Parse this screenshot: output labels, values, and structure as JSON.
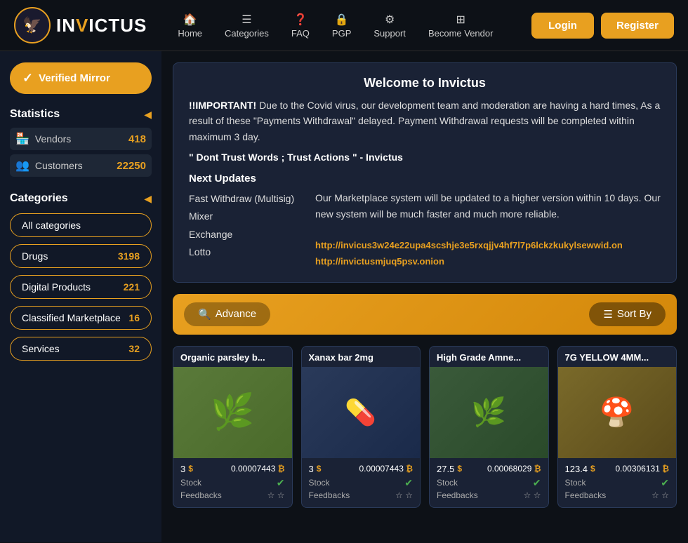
{
  "header": {
    "logo_text_main": "IN",
    "logo_text_v": "V",
    "logo_text_end": "ICTUS",
    "nav": [
      {
        "label": "Home",
        "icon": "🏠",
        "id": "home"
      },
      {
        "label": "Categories",
        "icon": "≡",
        "id": "categories"
      },
      {
        "label": "FAQ",
        "icon": "?",
        "id": "faq"
      },
      {
        "label": "PGP",
        "icon": "🔒",
        "id": "pgp"
      },
      {
        "label": "Support",
        "icon": "⚙",
        "id": "support"
      },
      {
        "label": "Become Vendor",
        "icon": "⊞",
        "id": "become-vendor"
      }
    ],
    "login_label": "Login",
    "register_label": "Register"
  },
  "sidebar": {
    "verified_mirror_label": "Verified Mirror",
    "statistics_title": "Statistics",
    "stats": [
      {
        "label": "Vendors",
        "value": "418",
        "icon": "🏪"
      },
      {
        "label": "Customers",
        "value": "22250",
        "icon": "👥"
      }
    ],
    "categories_title": "Categories",
    "categories": [
      {
        "label": "All categories",
        "count": null
      },
      {
        "label": "Drugs",
        "count": "3198"
      },
      {
        "label": "Digital Products",
        "count": "221"
      },
      {
        "label": "Classified Marketplace",
        "count": "16"
      },
      {
        "label": "Services",
        "count": "32"
      }
    ]
  },
  "welcome": {
    "title": "Welcome to Invictus",
    "important_text": "Due to the Covid virus, our development team and moderation are having a hard times, As a result of these \"Payments Withdrawal\" delayed. Payment Withdrawal requests will be completed within maximum 3 day.",
    "important_prefix": "!!IMPORTANT!",
    "quote": "\" Dont Trust Words ; Trust Actions \" - Invictus",
    "next_updates_title": "Next Updates",
    "updates_list": [
      "Fast Withdraw (Multisig)",
      "Mixer",
      "Exchange",
      "Lotto"
    ],
    "updates_desc": "Our Marketplace system will be updated to a higher version within 10 days. Our new system will be much faster and much more reliable.",
    "link1": "http://invicus3w24e22upa4scshje3e5rxqjjv4hf7l7p6lckzkukylsewwid.on",
    "link2": "http://invictusmjuq5psv.onion"
  },
  "search_bar": {
    "advance_label": "Advance",
    "sort_label": "Sort By",
    "search_icon": "🔍",
    "sort_icon": "≡"
  },
  "products": [
    {
      "title": "Organic parsley b...",
      "price_usd": "3",
      "price_btc": "0.00007443",
      "stock": true,
      "feedbacks": 2,
      "image_type": "parsley",
      "image_emoji": "🌿"
    },
    {
      "title": "Xanax bar 2mg",
      "price_usd": "3",
      "price_btc": "0.00007443",
      "stock": true,
      "feedbacks": 2,
      "image_type": "xanax",
      "image_emoji": "💊"
    },
    {
      "title": "High Grade Amne...",
      "price_usd": "27.5",
      "price_btc": "0.00068029",
      "stock": true,
      "feedbacks": 2,
      "image_type": "amnesia",
      "image_emoji": "🌿"
    },
    {
      "title": "7G YELLOW 4MM...",
      "price_usd": "123.4",
      "price_btc": "0.00306131",
      "stock": true,
      "feedbacks": 2,
      "image_type": "yellow",
      "image_emoji": "🍄"
    }
  ]
}
